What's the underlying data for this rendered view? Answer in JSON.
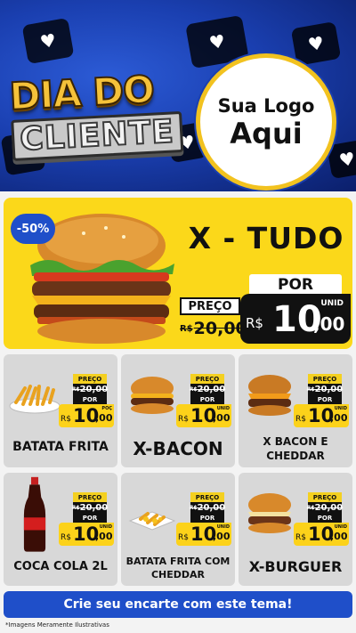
{
  "header": {
    "title_line1": "DIA DO",
    "title_line2": "CLIENTE",
    "logo_line1": "Sua Logo",
    "logo_line2": "Aqui",
    "decorations": "heart-icons"
  },
  "featured": {
    "discount": "-50%",
    "name": "X - TUDO",
    "old_label": "PREÇO",
    "old_currency": "R$",
    "old_price": "20,00",
    "new_label": "POR",
    "unit": "UNID",
    "currency": "R$",
    "price_int": "10",
    "price_dec": ",00",
    "icon": "burger-icon"
  },
  "products": [
    {
      "name": "BATATA FRITA",
      "old_currency": "R$",
      "old_price": "20,00",
      "currency": "R$",
      "price_int": "10",
      "price_dec": ",00",
      "unit": "POÇ",
      "icon": "fries-icon"
    },
    {
      "name": "X-BACON",
      "old_currency": "R$",
      "old_price": "20,00",
      "currency": "R$",
      "price_int": "10",
      "price_dec": ",00",
      "unit": "UNID",
      "icon": "burger-icon"
    },
    {
      "name": "X BACON E CHEDDAR",
      "old_currency": "R$",
      "old_price": "20,00",
      "currency": "R$",
      "price_int": "10",
      "price_dec": ",00",
      "unit": "UNID",
      "icon": "burger-cheddar-icon"
    },
    {
      "name": "COCA COLA 2L",
      "old_currency": "R$",
      "old_price": "20,00",
      "currency": "R$",
      "price_int": "10",
      "price_dec": ",00",
      "unit": "UNID",
      "icon": "soda-bottle-icon"
    },
    {
      "name": "BATATA FRITA COM CHEDDAR",
      "old_currency": "R$",
      "old_price": "20,00",
      "currency": "R$",
      "price_int": "10",
      "price_dec": ",00",
      "unit": "UNID",
      "icon": "fries-cheddar-icon"
    },
    {
      "name": "X-BURGUER",
      "old_currency": "R$",
      "old_price": "20,00",
      "currency": "R$",
      "price_int": "10",
      "price_dec": ",00",
      "unit": "UNID",
      "icon": "burger-icon"
    }
  ],
  "labels": {
    "preco": "PREÇO",
    "por": "POR"
  },
  "cta": "Crie seu encarte com este tema!",
  "disclaimer": "*Imagens Meramente Ilustrativas",
  "colors": {
    "yellow": "#fbd81a",
    "blue": "#1f4fc9",
    "dark": "#111111",
    "card": "#d8d8d8"
  }
}
